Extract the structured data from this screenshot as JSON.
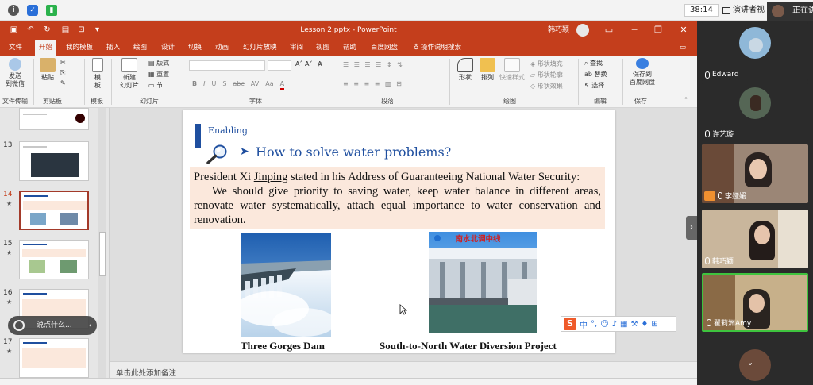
{
  "system_bar": {
    "timer": "38:14",
    "presenter_view": "演讲者视",
    "sharing_status": "正在讲"
  },
  "ppt": {
    "document_title": "Lesson 2.pptx - PowerPoint",
    "user_name": "韩巧颖",
    "accent_color": "#c43e1c",
    "tabs": [
      "文件",
      "开始",
      "我的模板",
      "插入",
      "绘图",
      "设计",
      "切换",
      "动画",
      "幻灯片放映",
      "审阅",
      "视图",
      "帮助",
      "百度网盘",
      "操作说明搜索"
    ],
    "active_tab": "开始",
    "ribbon": {
      "send_wechat": "发送\n到微信",
      "paste": "粘贴",
      "template": "模\n板",
      "new_slide": "新建\n幻灯片",
      "layout": "版式",
      "reset": "重置",
      "section": "节",
      "shape": "形状",
      "arrange": "排列",
      "quick_style": "快速样式",
      "shape_fill": "形状填充",
      "shape_outline": "形状轮廓",
      "shape_effect": "形状效果",
      "find": "查找",
      "replace": "替换",
      "select": "选择",
      "save_baidu": "保存到\n百度网盘",
      "groups": {
        "file_transfer": "文件传输",
        "clipboard": "剪贴板",
        "template": "模板",
        "slides": "幻灯片",
        "font": "字体",
        "paragraph": "段落",
        "drawing": "绘图",
        "editing": "编辑",
        "save": "保存"
      },
      "font_buttons": [
        "B",
        "I",
        "U",
        "S",
        "abc",
        "AV",
        "Aa",
        "A"
      ]
    },
    "thumbnails": [
      {
        "number": "13",
        "star": ""
      },
      {
        "number": "14",
        "star": "★"
      },
      {
        "number": "15",
        "star": "★"
      },
      {
        "number": "16",
        "star": "★"
      },
      {
        "number": "17",
        "star": "★"
      }
    ],
    "chat_placeholder": "说点什么...",
    "notes_placeholder": "单击此处添加备注",
    "slide": {
      "label": "Enabling",
      "heading": "How to solve water problems?",
      "quote_line1_before": "President Xi ",
      "quote_line1_underlined": "Jinping",
      "quote_line1_after": " stated in his Address of Guaranteeing National Water Security:",
      "quote_para": "We should give priority to saving water, keep water balance in different areas, renovate water systematically, attach equal importance to water conservation and renovation.",
      "image2_sign": "南水北调中线",
      "caption_left": "Three Gorges Dam",
      "caption_right": "South-to-North Water Diversion Project"
    },
    "ime": {
      "logo": "S",
      "mode": "中"
    }
  },
  "participants": [
    {
      "name": "Edward"
    },
    {
      "name": "许艺璇"
    },
    {
      "name": "李娅媛"
    },
    {
      "name": "韩巧颖"
    },
    {
      "name": "翟莉洲Amy"
    }
  ]
}
